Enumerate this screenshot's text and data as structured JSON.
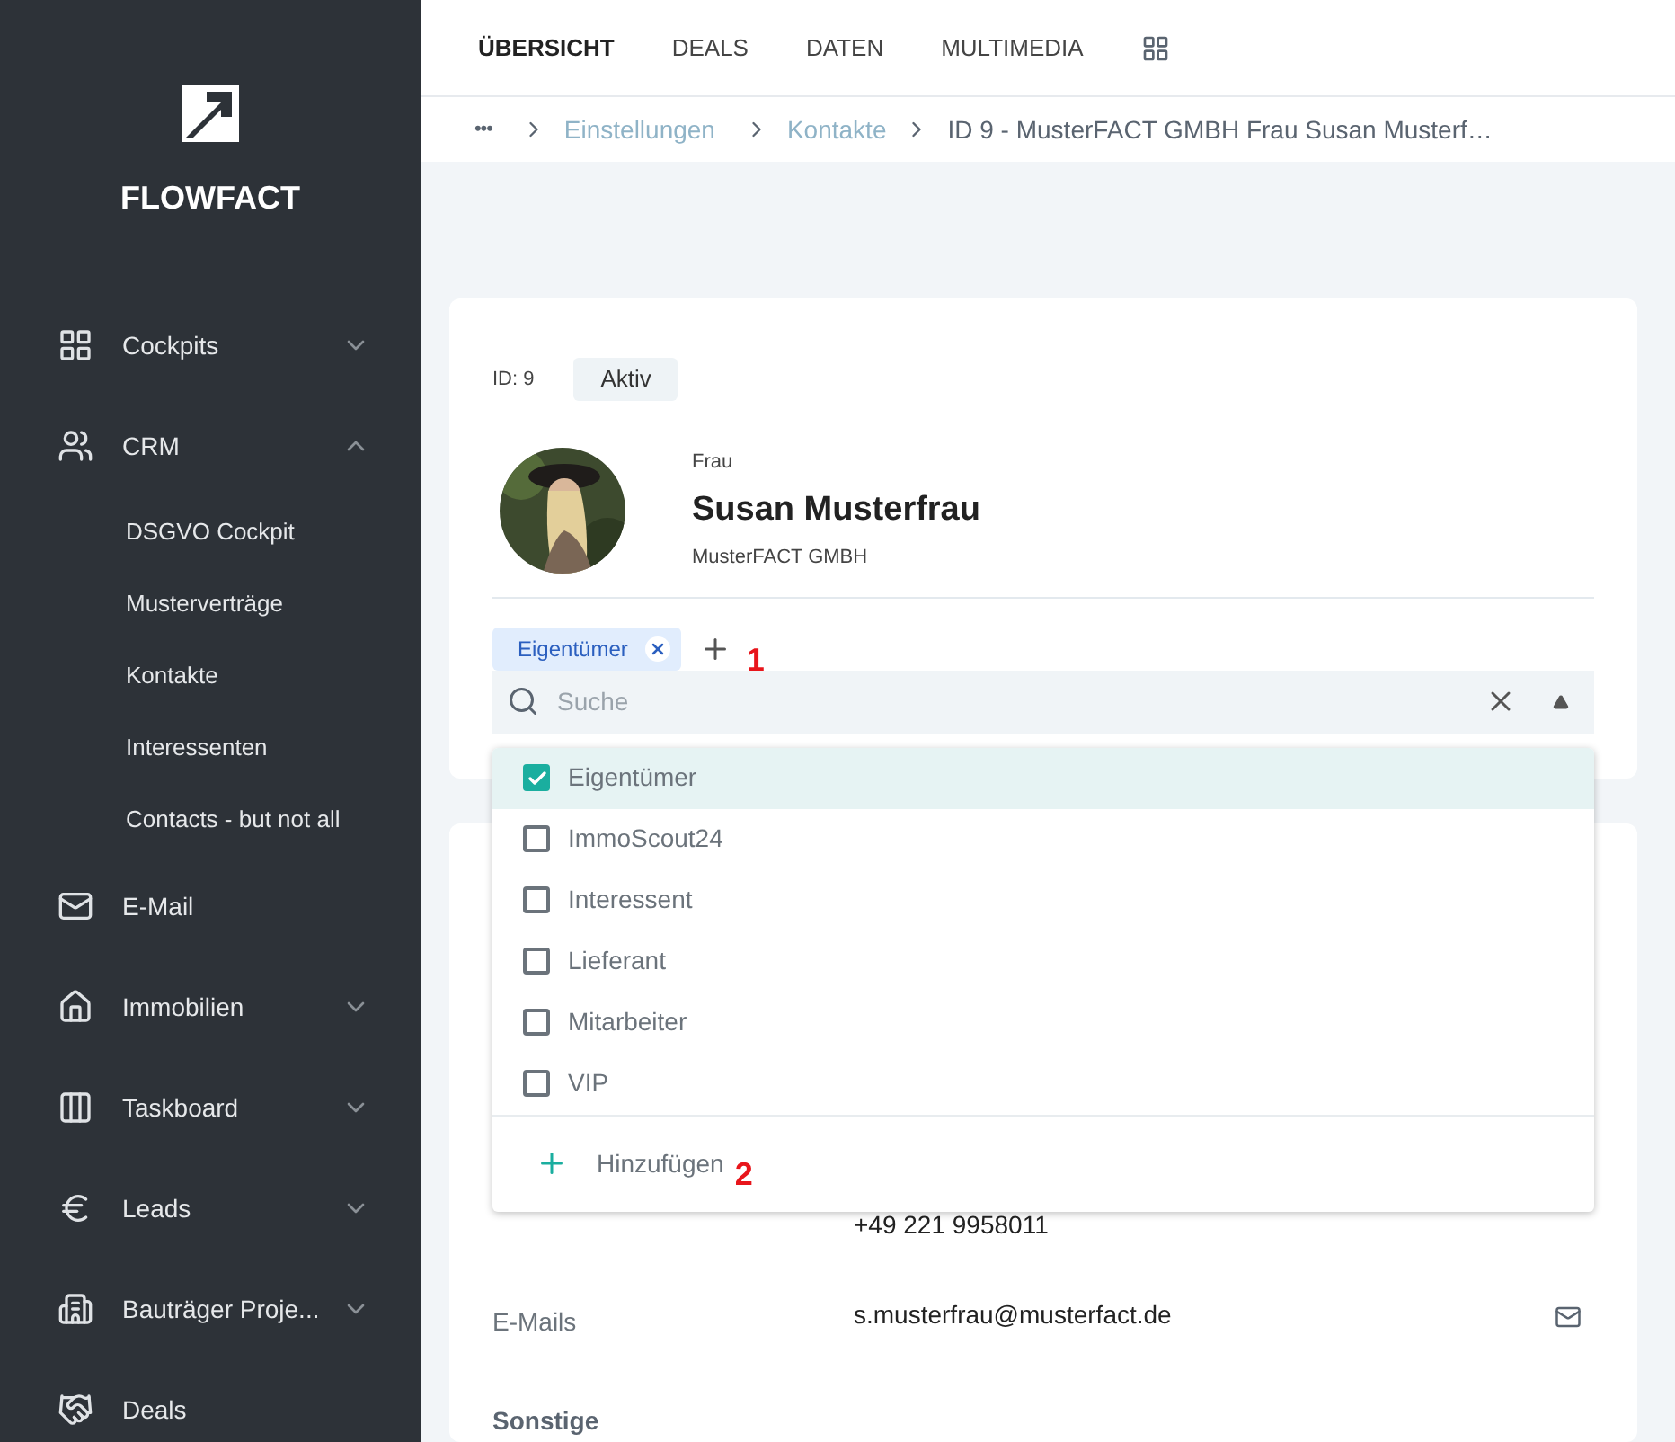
{
  "sidebar": {
    "brand": "FLOWFACT",
    "items": [
      {
        "label": "Cockpits",
        "expanded": false,
        "has_children": true
      },
      {
        "label": "CRM",
        "expanded": true,
        "has_children": true,
        "children": [
          {
            "label": "DSGVO Cockpit"
          },
          {
            "label": "Musterverträge"
          },
          {
            "label": "Kontakte"
          },
          {
            "label": "Interessenten"
          },
          {
            "label": "Contacts - but not all"
          }
        ]
      },
      {
        "label": "E-Mail",
        "has_children": false
      },
      {
        "label": "Immobilien",
        "expanded": false,
        "has_children": true
      },
      {
        "label": "Taskboard",
        "expanded": false,
        "has_children": true
      },
      {
        "label": "Leads",
        "expanded": false,
        "has_children": true
      },
      {
        "label": "Bauträger Proje...",
        "expanded": false,
        "has_children": true
      },
      {
        "label": "Deals",
        "has_children": false
      }
    ]
  },
  "tabs": [
    {
      "label": "ÜBERSICHT",
      "selected": true
    },
    {
      "label": "DEALS",
      "selected": false
    },
    {
      "label": "DATEN",
      "selected": false
    },
    {
      "label": "MULTIMEDIA",
      "selected": false
    }
  ],
  "breadcrumb": {
    "more": "•••",
    "links": [
      "Einstellungen",
      "Kontakte"
    ],
    "current": "ID 9 - MusterFACT GMBH Frau Susan Musterf…"
  },
  "contact": {
    "id": "ID: 9",
    "status": "Aktiv",
    "salutation": "Frau",
    "name": "Susan Musterfrau",
    "company": "MusterFACT GMBH",
    "tags": [
      {
        "label": "Eigentümer"
      }
    ],
    "annotation_1": "1"
  },
  "tag_picker": {
    "placeholder": "Suche",
    "expanded": true,
    "options": [
      {
        "label": "Eigentümer",
        "checked": true
      },
      {
        "label": "ImmoScout24",
        "checked": false
      },
      {
        "label": "Interessent",
        "checked": false
      },
      {
        "label": "Lieferant",
        "checked": false
      },
      {
        "label": "Mitarbeiter",
        "checked": false
      },
      {
        "label": "VIP",
        "checked": false
      }
    ],
    "add_label": "Hinzufügen",
    "annotation_2": "2"
  },
  "details": {
    "phone": "+49 221 9958011",
    "emails_label": "E-Mails",
    "email": "s.musterfrau@musterfact.de",
    "section": "Sonstige"
  }
}
